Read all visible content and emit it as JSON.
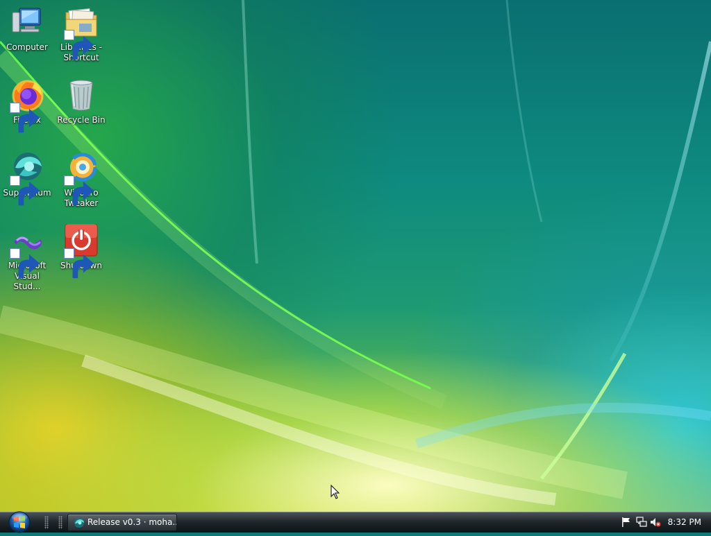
{
  "desktop": {
    "icons": [
      {
        "label": "Computer",
        "icon": "computer-icon",
        "shortcut": false
      },
      {
        "label": "Libraries - Shortcut",
        "icon": "libraries-folder-icon",
        "shortcut": true
      },
      {
        "label": "Firefox",
        "icon": "firefox-icon",
        "shortcut": true
      },
      {
        "label": "Recycle Bin",
        "icon": "recycle-bin-icon",
        "shortcut": false
      },
      {
        "label": "Supermium",
        "icon": "supermium-icon",
        "shortcut": true
      },
      {
        "label": "Winaero Tweaker",
        "icon": "winaero-tweaker-icon",
        "shortcut": true
      },
      {
        "label": "Microsoft Visual Stud...",
        "icon": "visual-studio-icon",
        "shortcut": true
      },
      {
        "label": "Shutdown",
        "icon": "shutdown-icon",
        "shortcut": true
      }
    ]
  },
  "taskbar": {
    "start_button": "start-orb-icon",
    "running_tasks": [
      {
        "label": "Release v0.3 · moha...",
        "icon": "supermium-icon"
      }
    ],
    "tray_icons": [
      "action-center-flag-icon",
      "network-icon",
      "volume-muted-icon"
    ],
    "clock": "8:32 PM"
  },
  "colors": {
    "taskbar_top": "#4a5257",
    "taskbar_bottom": "#0c1216",
    "wallpaper_teal": "#0e8a80",
    "wallpaper_yellow": "#c9d43a"
  }
}
